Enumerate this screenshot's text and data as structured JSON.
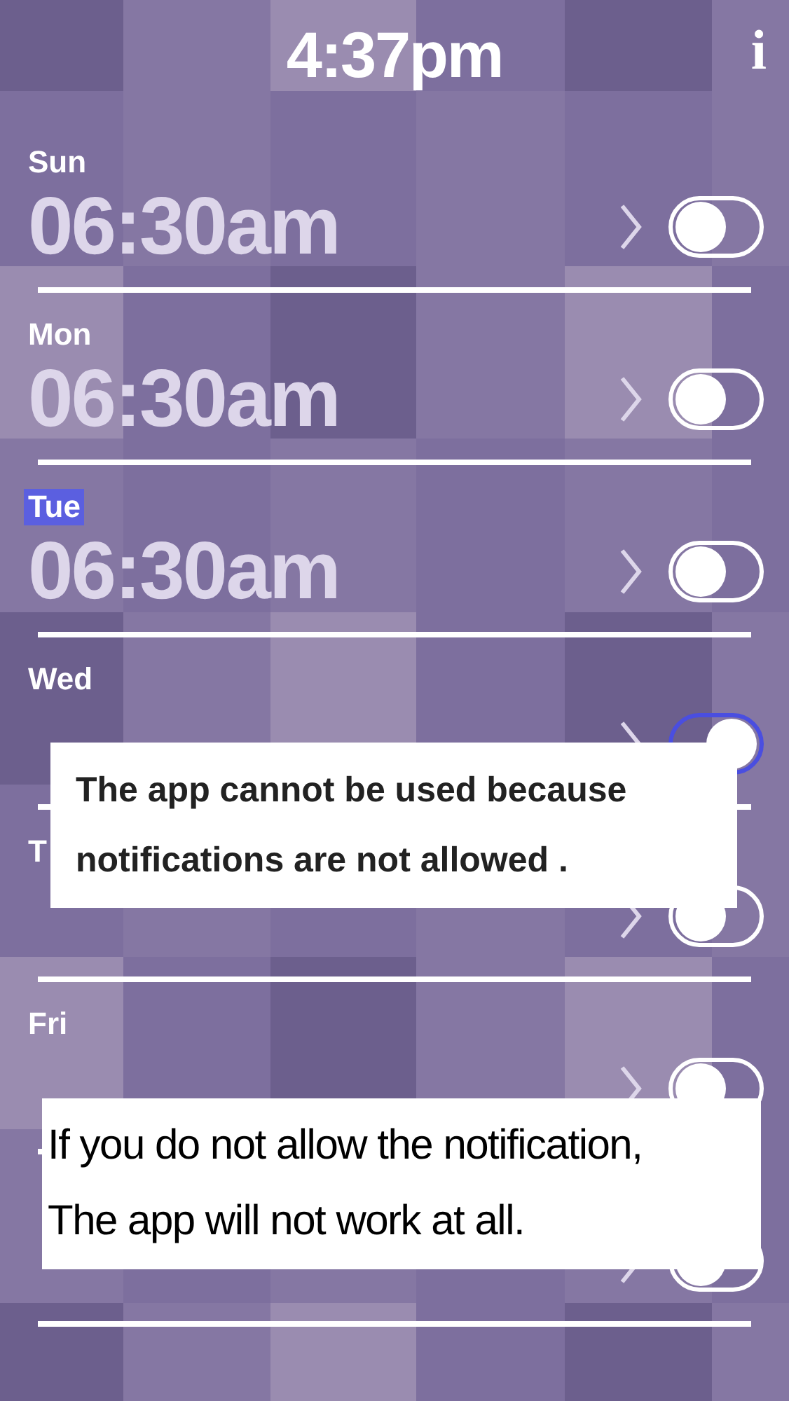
{
  "header": {
    "time": "4:37pm",
    "info_button": "i"
  },
  "alarms": [
    {
      "day": "Sun",
      "time": "06:30am",
      "selected": false,
      "on": false
    },
    {
      "day": "Mon",
      "time": "06:30am",
      "selected": false,
      "on": false
    },
    {
      "day": "Tue",
      "time": "06:30am",
      "selected": true,
      "on": false
    },
    {
      "day": "Wed",
      "selected": false,
      "on": true
    },
    {
      "day": "T",
      "selected": false,
      "on": false
    },
    {
      "day": "Fri",
      "selected": false,
      "on": false
    },
    {
      "on": false
    }
  ],
  "notices": [
    {
      "kind": "bold",
      "text": "The app cannot be used because\nnotifications are not allowed ."
    },
    {
      "kind": "plain",
      "text": "If you do not allow the notification,\nThe app will not work at all."
    }
  ]
}
